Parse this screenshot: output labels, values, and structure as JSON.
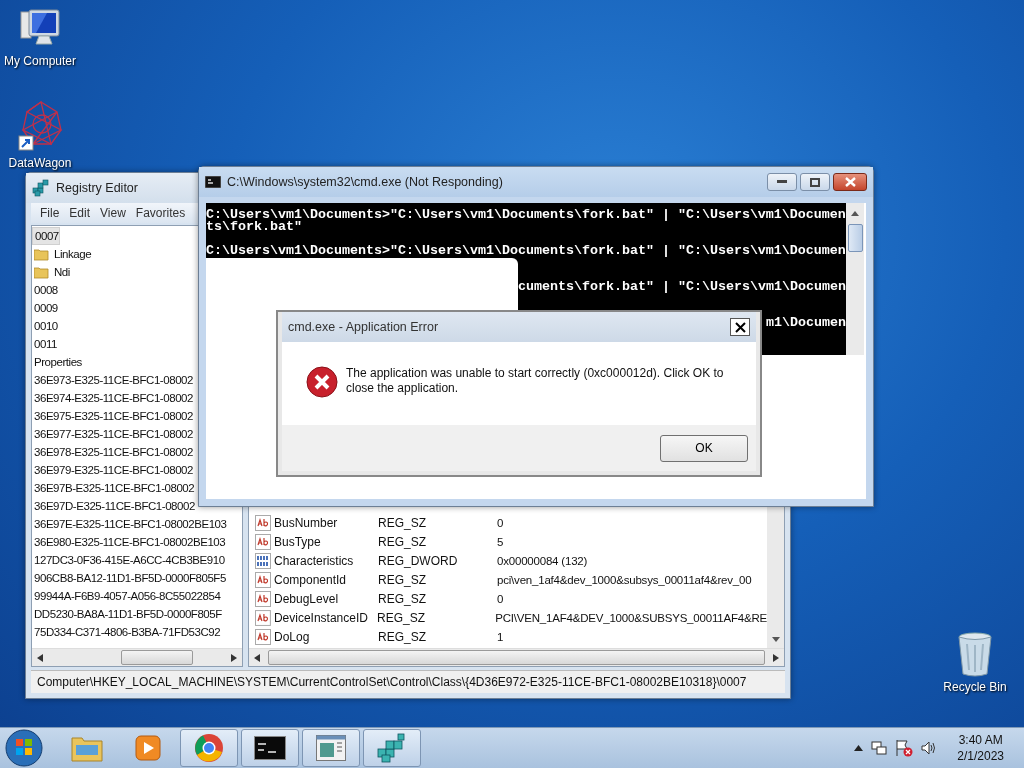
{
  "desktop_icons": [
    {
      "label": "My Computer",
      "kind": "computer"
    },
    {
      "label": "DataWagon",
      "kind": "datawagon"
    }
  ],
  "recycle_bin": {
    "label": "Recycle Bin"
  },
  "registry_editor": {
    "title": "Registry Editor",
    "menu": [
      "File",
      "Edit",
      "View",
      "Favorites"
    ],
    "tree": [
      {
        "label": "0007",
        "selected": true,
        "children": [
          {
            "label": "Linkage",
            "selected": false
          },
          {
            "label": "Ndi",
            "selected": false
          }
        ]
      },
      {
        "label": "0008",
        "selected": false
      },
      {
        "label": "0009",
        "selected": false
      },
      {
        "label": "0010",
        "selected": false
      },
      {
        "label": "0011",
        "selected": false
      },
      {
        "label": "Properties",
        "selected": false
      },
      {
        "label": "36E973-E325-11CE-BFC1-08002",
        "selected": false
      },
      {
        "label": "36E974-E325-11CE-BFC1-08002",
        "selected": false
      },
      {
        "label": "36E975-E325-11CE-BFC1-08002",
        "selected": false
      },
      {
        "label": "36E977-E325-11CE-BFC1-08002",
        "selected": false
      },
      {
        "label": "36E978-E325-11CE-BFC1-08002",
        "selected": false
      },
      {
        "label": "36E979-E325-11CE-BFC1-08002",
        "selected": false
      },
      {
        "label": "36E97B-E325-11CE-BFC1-08002",
        "selected": false
      },
      {
        "label": "36E97D-E325-11CE-BFC1-08002",
        "selected": false
      },
      {
        "label": "36E97E-E325-11CE-BFC1-08002BE103",
        "selected": false
      },
      {
        "label": "36E980-E325-11CE-BFC1-08002BE103",
        "selected": false
      },
      {
        "label": "127DC3-0F36-415E-A6CC-4CB3BE910",
        "selected": false
      },
      {
        "label": "906CB8-BA12-11D1-BF5D-0000F805F5",
        "selected": false
      },
      {
        "label": "99944A-F6B9-4057-A056-8C55022854",
        "selected": false
      },
      {
        "label": "DD5230-BA8A-11D1-BF5D-0000F805F",
        "selected": false
      },
      {
        "label": "75D334-C371-4806-B3BA-71FD53C92",
        "selected": false
      }
    ],
    "values": [
      {
        "name": "BusNumber",
        "type": "REG_SZ",
        "data": "0",
        "kind": "string"
      },
      {
        "name": "BusType",
        "type": "REG_SZ",
        "data": "5",
        "kind": "string"
      },
      {
        "name": "Characteristics",
        "type": "REG_DWORD",
        "data": "0x00000084 (132)",
        "kind": "dword"
      },
      {
        "name": "ComponentId",
        "type": "REG_SZ",
        "data": "pci\\ven_1af4&dev_1000&subsys_00011af4&rev_00",
        "kind": "string"
      },
      {
        "name": "DebugLevel",
        "type": "REG_SZ",
        "data": "0",
        "kind": "string"
      },
      {
        "name": "DeviceInstanceID",
        "type": "REG_SZ",
        "data": "PCI\\VEN_1AF4&DEV_1000&SUBSYS_00011AF4&RE",
        "kind": "string"
      },
      {
        "name": "DoLog",
        "type": "REG_SZ",
        "data": "1",
        "kind": "string"
      }
    ],
    "status_bar": "Computer\\HKEY_LOCAL_MACHINE\\SYSTEM\\CurrentControlSet\\Control\\Class\\{4D36E972-E325-11CE-BFC1-08002BE10318}\\0007"
  },
  "console": {
    "title": "C:\\Windows\\system32\\cmd.exe (Not Responding)",
    "lines": [
      {
        "text": "C:\\Users\\vm1\\Documents>\"C:\\Users\\vm1\\Documents\\fork.bat\" | \"C:\\Users\\vm1\\Documen",
        "kind": "full"
      },
      {
        "text": "ts\\fork.bat\"",
        "kind": "full"
      },
      {
        "text": "C:\\Users\\vm1\\Documents>\"C:\\Users\\vm1\\Documents\\fork.bat\" | \"C:\\Users\\vm1\\Documen",
        "kind": "full"
      },
      {
        "text": "cuments\\fork.bat\" | \"C:\\Users\\vm1\\Documen",
        "kind": "tail"
      },
      {
        "text": "m1\\Documen",
        "kind": "tail"
      }
    ]
  },
  "error_dialog": {
    "title": "cmd.exe - Application Error",
    "message": "The application was unable to start correctly (0xc000012d). Click OK to close the application.",
    "button": "OK"
  },
  "taskbar": {
    "items": [
      {
        "kind": "folder",
        "open": false
      },
      {
        "kind": "media",
        "open": false
      },
      {
        "kind": "chrome",
        "open": true
      },
      {
        "kind": "console",
        "open": true
      },
      {
        "kind": "window",
        "open": true
      },
      {
        "kind": "registry",
        "open": true
      }
    ],
    "time": "3:40 AM",
    "date": "2/1/2023"
  }
}
